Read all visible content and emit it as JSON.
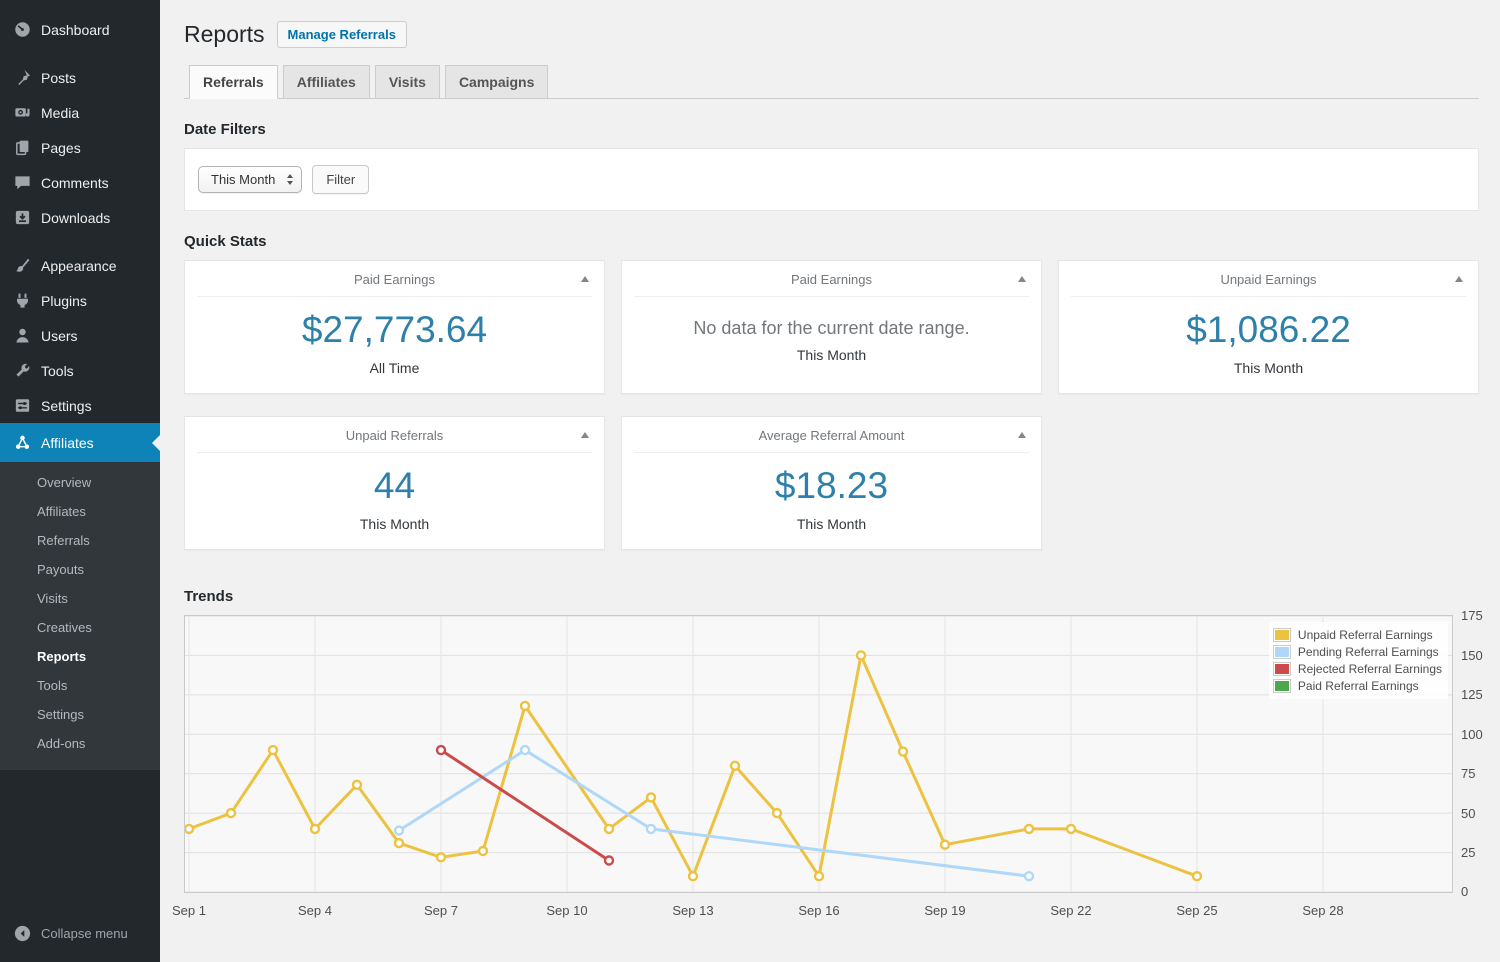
{
  "sidebar": {
    "items": [
      {
        "label": "Dashboard",
        "icon": "dashboard"
      },
      {
        "label": "Posts",
        "icon": "pin",
        "gap_before": true
      },
      {
        "label": "Media",
        "icon": "media"
      },
      {
        "label": "Pages",
        "icon": "pages"
      },
      {
        "label": "Comments",
        "icon": "comments"
      },
      {
        "label": "Downloads",
        "icon": "download"
      },
      {
        "label": "Appearance",
        "icon": "brush",
        "gap_before": true
      },
      {
        "label": "Plugins",
        "icon": "plug"
      },
      {
        "label": "Users",
        "icon": "user"
      },
      {
        "label": "Tools",
        "icon": "wrench"
      },
      {
        "label": "Settings",
        "icon": "sliders"
      }
    ],
    "affiliates": {
      "label": "Affiliates",
      "icon": "affiliates",
      "active": true
    },
    "submenu": [
      {
        "label": "Overview"
      },
      {
        "label": "Affiliates"
      },
      {
        "label": "Referrals"
      },
      {
        "label": "Payouts"
      },
      {
        "label": "Visits"
      },
      {
        "label": "Creatives"
      },
      {
        "label": "Reports",
        "active": true
      },
      {
        "label": "Tools"
      },
      {
        "label": "Settings"
      },
      {
        "label": "Add-ons"
      }
    ],
    "collapse_label": "Collapse menu"
  },
  "header": {
    "title": "Reports",
    "action_label": "Manage Referrals"
  },
  "tabs": [
    {
      "label": "Referrals",
      "active": true
    },
    {
      "label": "Affiliates"
    },
    {
      "label": "Visits"
    },
    {
      "label": "Campaigns"
    }
  ],
  "sections": {
    "filters": "Date Filters",
    "stats": "Quick Stats",
    "trends": "Trends"
  },
  "filters": {
    "range_value": "This Month",
    "button_label": "Filter"
  },
  "cards": [
    {
      "title": "Paid Earnings",
      "value": "$27,773.64",
      "period": "All Time"
    },
    {
      "title": "Paid Earnings",
      "message": "No data for the current date range.",
      "period": "This Month"
    },
    {
      "title": "Unpaid Earnings",
      "value": "$1,086.22",
      "period": "This Month"
    },
    {
      "title": "Unpaid Referrals",
      "value": "44",
      "period": "This Month"
    },
    {
      "title": "Average Referral Amount",
      "value": "$18.23",
      "period": "This Month"
    }
  ],
  "chart_data": {
    "type": "line",
    "title": "Trends",
    "x_axis": {
      "tick_days": [
        1,
        4,
        7,
        10,
        13,
        16,
        19,
        22,
        25,
        28
      ],
      "tick_labels": [
        "Sep 1",
        "Sep 4",
        "Sep 7",
        "Sep 10",
        "Sep 13",
        "Sep 16",
        "Sep 19",
        "Sep 22",
        "Sep 25",
        "Sep 28"
      ]
    },
    "y_axis": {
      "ticks": [
        0,
        25,
        50,
        75,
        100,
        125,
        150,
        175
      ],
      "max": 175,
      "position": "right"
    },
    "legend_position": "top-right",
    "grid": true,
    "series": [
      {
        "name": "Unpaid Referral Earnings",
        "color": "#edc240",
        "points": [
          [
            1,
            40
          ],
          [
            2,
            50
          ],
          [
            3,
            90
          ],
          [
            4,
            40
          ],
          [
            5,
            68
          ],
          [
            6,
            31
          ],
          [
            7,
            22
          ],
          [
            8,
            26
          ],
          [
            9,
            118
          ],
          [
            11,
            40
          ],
          [
            12,
            60
          ],
          [
            13,
            10
          ],
          [
            14,
            80
          ],
          [
            15,
            50
          ],
          [
            16,
            10
          ],
          [
            17,
            150
          ],
          [
            18,
            89
          ],
          [
            19,
            30
          ],
          [
            21,
            40
          ],
          [
            22,
            40
          ],
          [
            25,
            10
          ]
        ]
      },
      {
        "name": "Pending Referral Earnings",
        "color": "#afd8f8",
        "points": [
          [
            6,
            39
          ],
          [
            9,
            90
          ],
          [
            12,
            40
          ],
          [
            21,
            10
          ]
        ]
      },
      {
        "name": "Rejected Referral Earnings",
        "color": "#cb4b4b",
        "points": [
          [
            7,
            90
          ],
          [
            11,
            20
          ]
        ]
      },
      {
        "name": "Paid Referral Earnings",
        "color": "#4da74d",
        "points": []
      }
    ]
  },
  "colors": {
    "sidebar_bg": "#23282d",
    "submenu_bg": "#32373c",
    "menu_active_bg": "#0e83b7",
    "accent_blue": "#0073aa",
    "stat_value_blue": "#2d80aa",
    "page_bg": "#f1f1f1",
    "series_unpaid": "#edc240",
    "series_pending": "#afd8f8",
    "series_rejected": "#cb4b4b",
    "series_paid": "#4da74d"
  }
}
